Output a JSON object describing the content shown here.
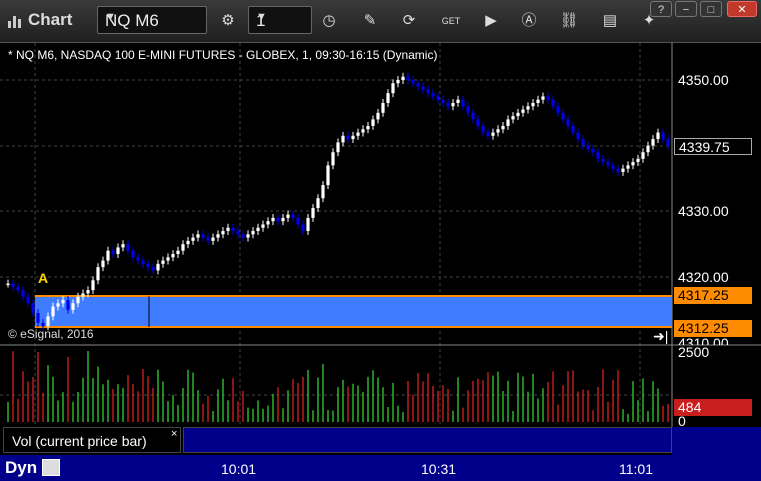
{
  "app": {
    "title": "Chart"
  },
  "toolbar": {
    "symbol": "NQ M6",
    "interval": "1"
  },
  "chart": {
    "symbol_line": "* NQ M6, NASDAQ 100 E-MINI FUTURES - GLOBEX, 1, 09:30-16:15 (Dynamic)",
    "copyright": "© eSignal, 2016",
    "marker": "A",
    "price_axis": [
      "4350.00",
      "4330.00",
      "4320.00",
      "4310.00"
    ],
    "last_price": "4339.75",
    "band_top": "4317.25",
    "band_bottom": "4312.25",
    "volume_axis": [
      "2500",
      "0"
    ],
    "volume_last": "484",
    "volume_label": "Vol (current price bar)",
    "volume_close": "×",
    "time_axis": [
      "10:01",
      "10:31",
      "11:01"
    ],
    "dyn_label": "Dyn",
    "colors": {
      "up": "#ffffff",
      "down": "#0000ee",
      "band": "#3f7cff",
      "band_edge": "#ff8c00",
      "vol_up": "#2fbf2f",
      "vol_down": "#c81e1e",
      "axis_bg": "#00008b"
    }
  }
}
